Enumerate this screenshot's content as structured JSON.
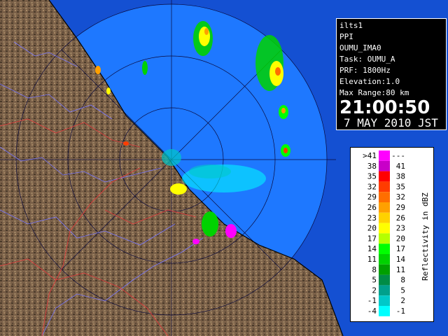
{
  "info": {
    "station": "ilts1",
    "scan_type": "PPI",
    "site": "OUMU_IMA0",
    "task": "Task: OUMU_A",
    "prf": "PRF: 1800Hz",
    "elevation": "Elevation:1.0",
    "max_range": "Max Range:80 km",
    "time": "21:00:50",
    "date": "7 MAY 2010 JST"
  },
  "legend": {
    "axis_label": "Reflectivity in dBZ",
    "rows": [
      {
        "left": ">41",
        "right": "---",
        "color": "#ff00ff"
      },
      {
        "left": "38",
        "right": "41",
        "color": "#c800c8"
      },
      {
        "left": "35",
        "right": "38",
        "color": "#ff0000"
      },
      {
        "left": "32",
        "right": "35",
        "color": "#ff3c00"
      },
      {
        "left": "29",
        "right": "32",
        "color": "#ff6e00"
      },
      {
        "left": "26",
        "right": "29",
        "color": "#ffa000"
      },
      {
        "left": "23",
        "right": "26",
        "color": "#ffd200"
      },
      {
        "left": "20",
        "right": "23",
        "color": "#ffff00"
      },
      {
        "left": "17",
        "right": "20",
        "color": "#b4ff00"
      },
      {
        "left": "14",
        "right": "17",
        "color": "#00ff00"
      },
      {
        "left": "11",
        "right": "14",
        "color": "#00d200"
      },
      {
        "left": "8",
        "right": "11",
        "color": "#00a000"
      },
      {
        "left": "5",
        "right": "8",
        "color": "#008c46"
      },
      {
        "left": "2",
        "right": "5",
        "color": "#00a08c"
      },
      {
        "left": "-1",
        "right": "2",
        "color": "#00c8c8"
      },
      {
        "left": "-4",
        "right": "-1",
        "color": "#00ffff"
      }
    ]
  },
  "colors": {
    "sea": "#1e78ff",
    "outer_range": "#1450d2",
    "land": "#7a6048",
    "land_dark": "#4a3a2a",
    "rivers": "#7878ff",
    "boundaries": "#dc3c3c",
    "range_rings": "#0a0a3c"
  }
}
